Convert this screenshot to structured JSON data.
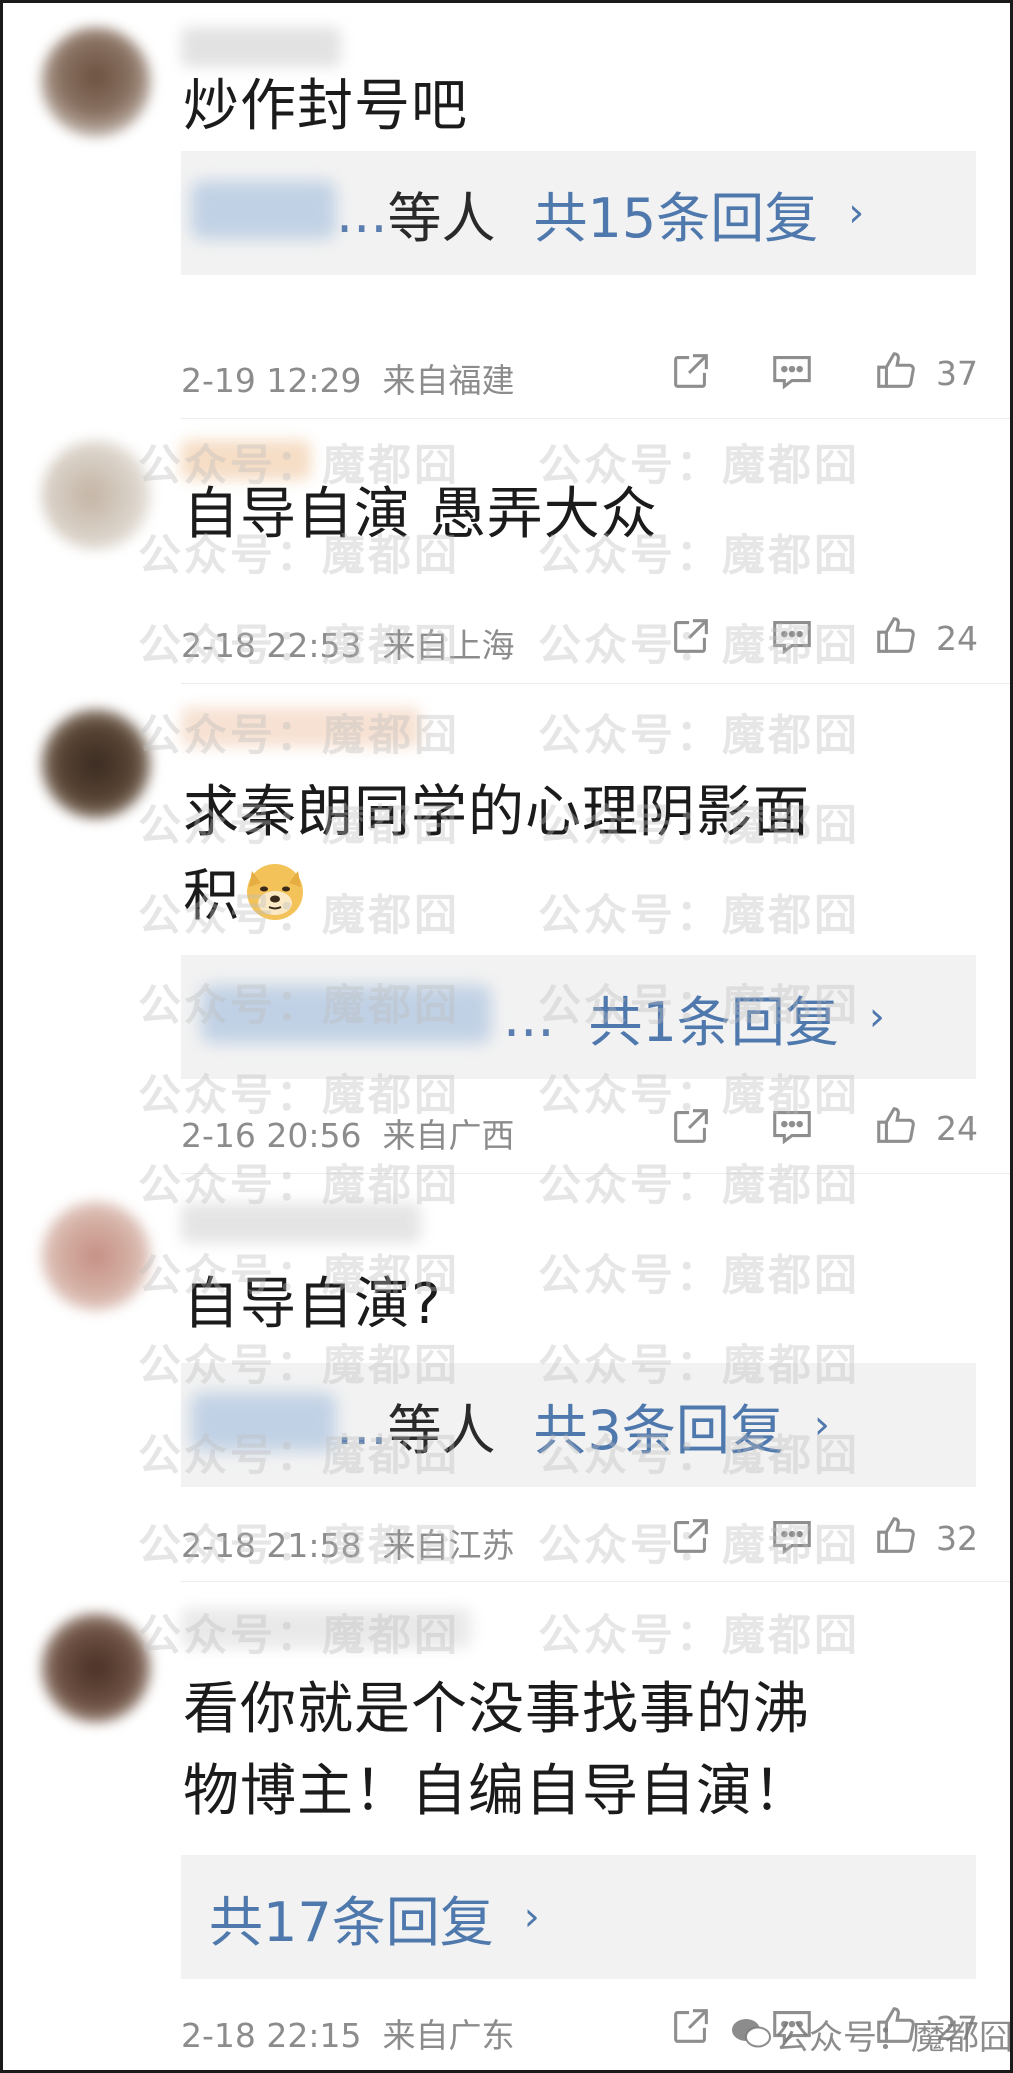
{
  "comments": [
    {
      "text": "炒作封号吧",
      "reply": {
        "ellipsis": "...",
        "suffix": "等人",
        "link": "共15条回复",
        "chevron": "›"
      },
      "time": "2-19 12:29",
      "location": "来自福建",
      "likes": "37"
    },
    {
      "text": "自导自演 愚弄大众",
      "time": "2-18 22:53",
      "location": "来自上海",
      "likes": "24"
    },
    {
      "text_line1": "求秦朗同学的心理阴影面",
      "text_line2": "积",
      "emoji": "doge-emoji",
      "reply": {
        "ellipsis": "...",
        "link": "共1条回复",
        "chevron": "›"
      },
      "time": "2-16 20:56",
      "location": "来自广西",
      "likes": "24"
    },
    {
      "text": "自导自演?",
      "reply": {
        "ellipsis": "...",
        "suffix": "等人",
        "link": "共3条回复",
        "chevron": "›"
      },
      "time": "2-18 21:58",
      "location": "来自江苏",
      "likes": "32"
    },
    {
      "text_line1": "看你就是个没事找事的沸",
      "text_line2": "物博主！自编自导自演！",
      "reply": {
        "link": "共17条回复",
        "chevron": "›"
      },
      "time": "2-18 22:15",
      "location": "来自广东",
      "likes": "27"
    }
  ],
  "icons": {
    "share": "share-icon",
    "comment": "comment-icon",
    "like": "thumbs-up-icon"
  },
  "watermark": {
    "text": "公众号：魔都囧",
    "footer": "公众号：魔都囧"
  },
  "colors": {
    "link": "#4f78ad",
    "meta": "#8c8c8c",
    "reply_bg": "#f2f2f2"
  }
}
